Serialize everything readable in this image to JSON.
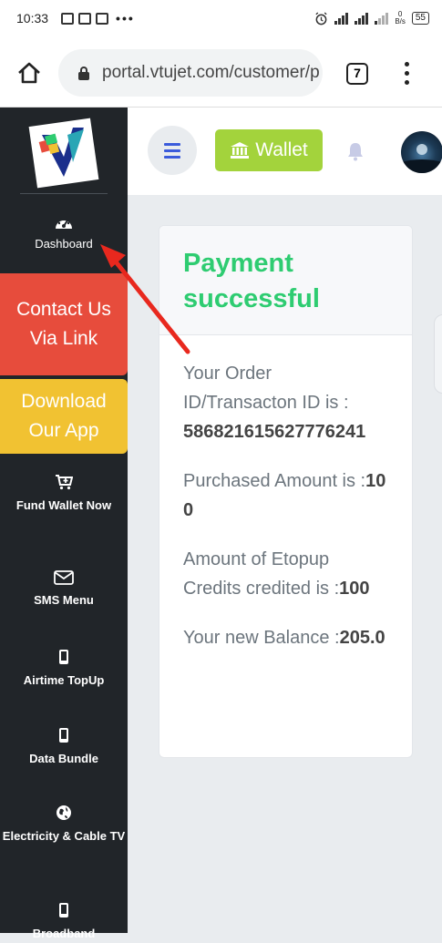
{
  "status_bar": {
    "time": "10:33",
    "more_dots": "•••",
    "battery": "55",
    "netspeed_top": "0",
    "netspeed_bottom": "B/s"
  },
  "browser": {
    "url": "portal.vtujet.com/customer/p",
    "tab_count": "7"
  },
  "sidebar": {
    "dashboard_label": "Dashboard",
    "contact_label": "Contact Us Via Link",
    "download_label": "Download Our App",
    "items": [
      {
        "label": "Fund Wallet Now",
        "icon": "cart-plus-icon"
      },
      {
        "label": "SMS Menu",
        "icon": "envelope-icon"
      },
      {
        "label": "Airtime TopUp",
        "icon": "mobile-icon"
      },
      {
        "label": "Data Bundle",
        "icon": "mobile-icon"
      },
      {
        "label": "Electricity & Cable TV",
        "icon": "globe-icon"
      },
      {
        "label": "Broadband",
        "icon": "mobile-icon"
      }
    ]
  },
  "header": {
    "wallet_label": "Wallet"
  },
  "card": {
    "title": "Payment successful",
    "order_prefix": "Your Order ID/Transacton ID is :",
    "order_id": "586821615627776241",
    "purchased_prefix": "Purchased Amount is :",
    "purchased_value": "100",
    "credited_prefix": "Amount of Etopup Credits credited is :",
    "credited_value": "100",
    "balance_prefix": "Your new Balance :",
    "balance_value": "205.0"
  },
  "colors": {
    "sidebar_bg": "#212529",
    "contact_bg": "#e74c3c",
    "download_bg": "#f1c232",
    "wallet_bg": "#a3d33c",
    "success_green": "#2ecc71",
    "annotation_arrow": "#e8281e"
  }
}
